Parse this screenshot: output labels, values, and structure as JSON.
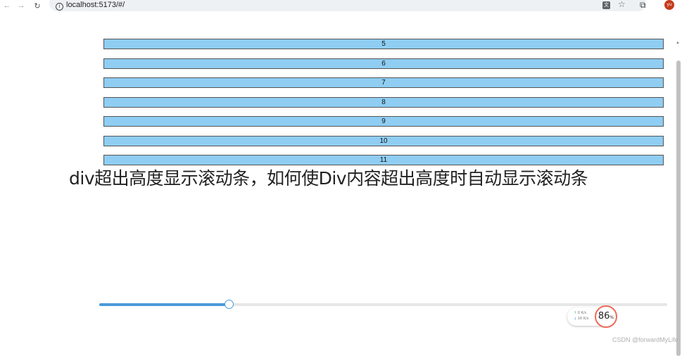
{
  "browser": {
    "url": "localhost:5173/#/",
    "back_icon": "←",
    "forward_icon": "→",
    "reload_icon": "↻",
    "info_icon": "i",
    "translate_icon": "文",
    "star_icon": "☆",
    "extensions_icon": "⧉",
    "avatar_initials": "yu",
    "avatar_color": "#c53a1a"
  },
  "list": {
    "row_color": "#8fcdf2",
    "rows": [
      "5",
      "6",
      "7",
      "8",
      "9",
      "10",
      "11"
    ]
  },
  "title": "div超出高度显示滚动条，如何使Div内容超出高度时自动显示滚动条",
  "slider": {
    "value_fraction": 0.228,
    "accent_color": "#4a9ad8"
  },
  "network": {
    "up_arrow": "↑",
    "up_value": "0",
    "up_unit": "K/s",
    "down_arrow": "↓",
    "down_value": "16",
    "down_unit": "K/s",
    "percent": "86",
    "percent_sign": "%"
  },
  "watermark": "CSDN @forwardMyLife"
}
